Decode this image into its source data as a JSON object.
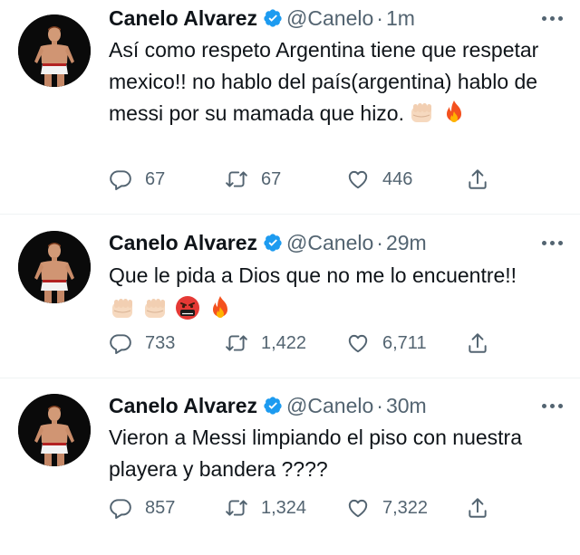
{
  "tweets": [
    {
      "author": {
        "name": "Canelo Alvarez",
        "handle": "@Canelo",
        "verified": true
      },
      "time": "1m",
      "separator": "·",
      "text": "Así como respeto Argentina tiene que respetar mexico!! no hablo del país(argentina) hablo de messi por su mamada que hizo.",
      "emojis": [
        "fist-emoji",
        "fire-emoji"
      ],
      "stats": {
        "replies": "67",
        "retweets": "67",
        "likes": "446"
      }
    },
    {
      "author": {
        "name": "Canelo Alvarez",
        "handle": "@Canelo",
        "verified": true
      },
      "time": "29m",
      "separator": "·",
      "text": "Que le pida a Dios que no me lo encuentre!!",
      "emojis": [
        "fist-emoji",
        "fist-emoji",
        "cursing-face-emoji",
        "fire-emoji"
      ],
      "stats": {
        "replies": "733",
        "retweets": "1,422",
        "likes": "6,711"
      }
    },
    {
      "author": {
        "name": "Canelo Alvarez",
        "handle": "@Canelo",
        "verified": true
      },
      "time": "30m",
      "separator": "·",
      "text": "Vieron a Messi limpiando el piso con nuestra playera y bandera ????",
      "emojis": [],
      "stats": {
        "replies": "857",
        "retweets": "1,324",
        "likes": "7,322"
      }
    }
  ],
  "colors": {
    "text": "#0f1419",
    "secondary": "#536471",
    "verified": "#1d9bf0",
    "divider": "#eff3f4"
  },
  "icons": [
    "reply-icon",
    "retweet-icon",
    "like-icon",
    "share-icon",
    "more-icon",
    "verified-badge-icon"
  ]
}
